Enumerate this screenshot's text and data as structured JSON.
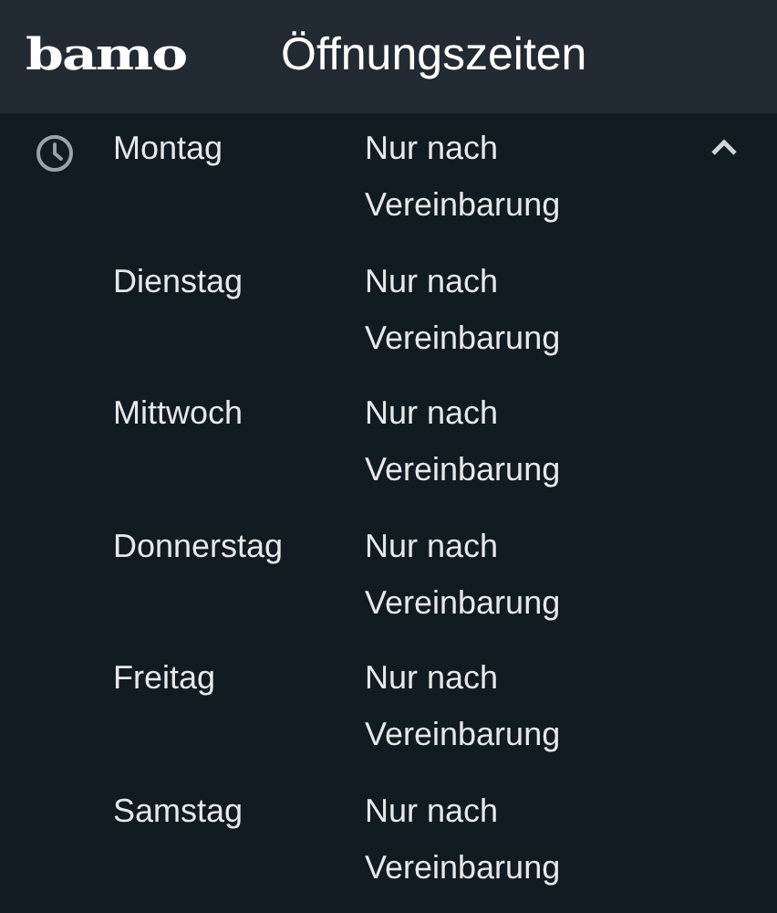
{
  "header": {
    "logo": "bamo",
    "title": "Öffnungszeiten"
  },
  "hours": {
    "expanded": true,
    "days": [
      {
        "day": "Montag",
        "hours": "Nur nach Vereinbarung"
      },
      {
        "day": "Dienstag",
        "hours": "Nur nach Vereinbarung"
      },
      {
        "day": "Mittwoch",
        "hours": "Nur nach Vereinbarung"
      },
      {
        "day": "Donnerstag",
        "hours": "Nur nach Vereinbarung"
      },
      {
        "day": "Freitag",
        "hours": "Nur nach Vereinbarung"
      },
      {
        "day": "Samstag",
        "hours": "Nur nach Vereinbarung"
      }
    ]
  }
}
